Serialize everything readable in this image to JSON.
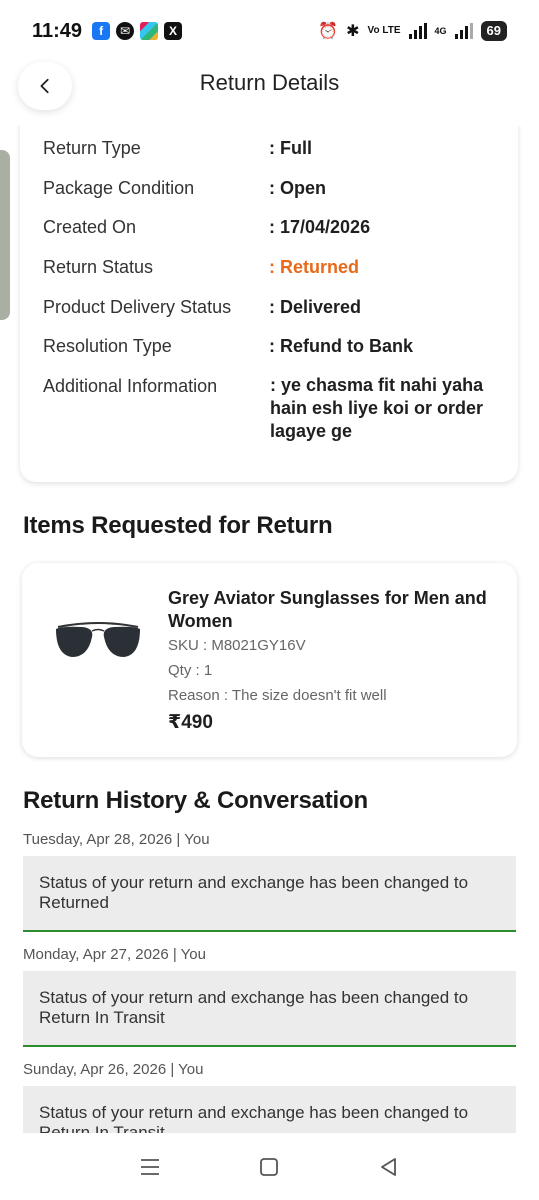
{
  "status_bar": {
    "time": "11:49",
    "battery": "69",
    "network_label": "Vo LTE",
    "signal_label": "4G"
  },
  "header": {
    "title": "Return Details"
  },
  "details": [
    {
      "label": "Return Type",
      "value": ": Full"
    },
    {
      "label": "Package Condition",
      "value": ": Open"
    },
    {
      "label": "Created On",
      "value": ": 17/04/2026"
    },
    {
      "label": "Return Status",
      "value": ": Returned"
    },
    {
      "label": "Product Delivery Status",
      "value": ": Delivered"
    },
    {
      "label": "Resolution Type",
      "value": ": Refund to Bank"
    },
    {
      "label": "Additional Information",
      "value": ": ye chasma fit nahi yaha hain esh liye koi or order lagaye ge"
    }
  ],
  "accent_color": "#e8691a",
  "items_section": {
    "title": "Items Requested for Return",
    "item": {
      "name": "Grey Aviator Sunglasses for Men and Women",
      "sku": "SKU : M8021GY16V",
      "qty": "Qty : 1",
      "reason": "Reason : The size doesn't fit well",
      "price": "₹490"
    }
  },
  "history_section": {
    "title": "Return History & Conversation",
    "entries": [
      {
        "date": "Tuesday, Apr 28, 2026 | You",
        "message": "Status of your return and exchange has been changed to Returned"
      },
      {
        "date": "Monday, Apr 27, 2026 | You",
        "message": "Status of your return and exchange has been changed to Return In Transit"
      },
      {
        "date": "Sunday, Apr 26, 2026 | You",
        "message": "Status of your return and exchange has been changed to Return In Transit"
      }
    ]
  }
}
